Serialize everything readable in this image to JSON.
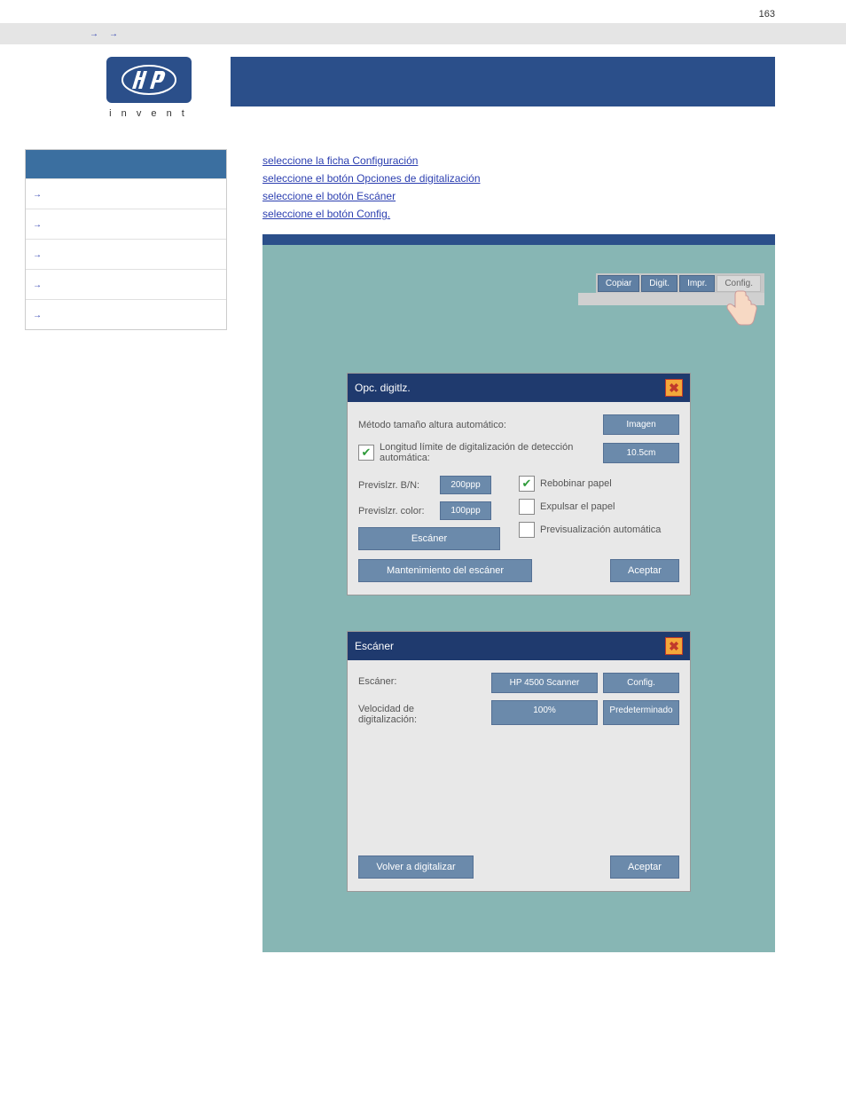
{
  "page_number": "163",
  "breadcrumb": {
    "item1": "",
    "item2": ""
  },
  "logo_sub": "i n v e n t",
  "nav": {
    "items": [
      {
        "label": ""
      },
      {
        "label": ""
      },
      {
        "label": ""
      },
      {
        "label": ""
      },
      {
        "label": ""
      }
    ]
  },
  "steps": {
    "s1": "seleccione la ficha Configuración",
    "s2": "seleccione el botón Opciones de digitalización",
    "s3": "seleccione el botón Escáner",
    "s4": "seleccione el botón Config."
  },
  "section1_title": "",
  "tabs": {
    "t1": "Copiar",
    "t2": "Digit.",
    "t3": "Impr.",
    "t4": "Config."
  },
  "dlg1": {
    "title": "Opc. digitlz.",
    "auto_height_label": "Método tamaño altura automático:",
    "auto_height_value": "Imagen",
    "limit_label": "Longitud límite de digitalización de detección automática:",
    "limit_value": "10.5cm",
    "prev_bn_label": "Previslzr. B/N:",
    "prev_bn_value": "200ppp",
    "prev_color_label": "Previslzr. color:",
    "prev_color_value": "100ppp",
    "scanner_btn": "Escáner",
    "rewind_label": "Rebobinar papel",
    "eject_label": "Expulsar el papel",
    "autoprev_label": "Previsualización automática",
    "maint_btn": "Mantenimiento del escáner",
    "ok_btn": "Aceptar"
  },
  "dlg2": {
    "title": "Escáner",
    "scanner_label": "Escáner:",
    "scanner_value": "HP 4500 Scanner",
    "config_btn": "Config.",
    "speed_label": "Velocidad de digitalización:",
    "speed_value": "100%",
    "default_btn": "Predeterminado",
    "rescan_btn": "Volver a digitalizar",
    "ok_btn": "Aceptar"
  }
}
